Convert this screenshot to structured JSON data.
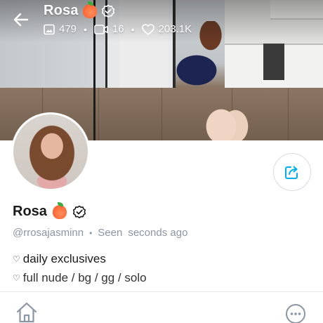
{
  "header": {
    "name": "Rosa",
    "verified_icon": "verified-badge-icon",
    "name_emoji_icon": "peach-emoji-icon",
    "stats": {
      "photos": "479",
      "videos": "16",
      "likes": "203.1K"
    }
  },
  "profile": {
    "name": "Rosa",
    "username": "@rrosajasminn",
    "seen_label": "Seen",
    "seen_time": "seconds ago",
    "bio": [
      "daily exclusives",
      "full nude / bg / gg / solo"
    ],
    "bio_bullet": "♡"
  },
  "icons": {
    "back": "arrow-left-icon",
    "photos": "image-icon",
    "videos": "video-icon",
    "likes": "heart-icon",
    "share": "share-icon",
    "home": "home-icon",
    "more": "more-icon"
  },
  "colors": {
    "accent": "#00aff0",
    "muted_text": "#8a96a3",
    "divider": "#e6e9ed"
  }
}
